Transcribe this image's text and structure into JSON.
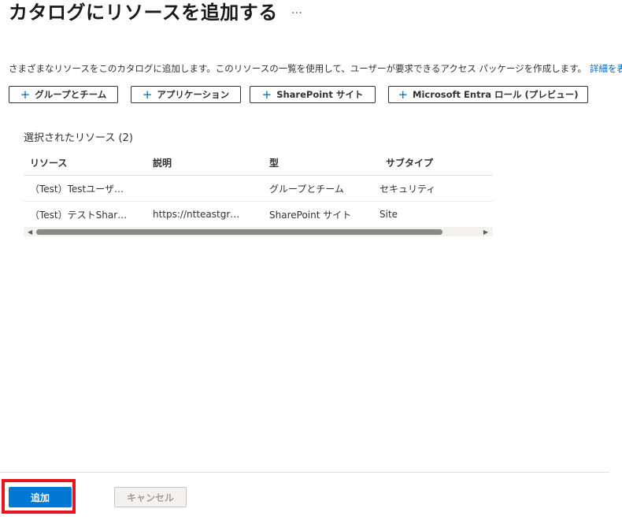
{
  "header": {
    "title": "カタログにリソースを追加する",
    "more_icon": "…"
  },
  "description": {
    "text": "さまざまなリソースをこのカタログに追加します。このリソースの一覧を使用して、ユーザーが要求できるアクセス パッケージを作成します。",
    "link": "詳細を表示"
  },
  "toolbar": {
    "buttons": [
      {
        "icon": "plus-icon",
        "label": "グループとチーム"
      },
      {
        "icon": "plus-icon",
        "label": "アプリケーション"
      },
      {
        "icon": "plus-icon",
        "label": "SharePoint サイト"
      },
      {
        "icon": "plus-icon",
        "label": "Microsoft Entra ロール (プレビュー)"
      }
    ]
  },
  "selected": {
    "label": "選択されたリソース (2)",
    "columns": [
      "リソース",
      "説明",
      "型",
      "サブタイプ"
    ],
    "rows": [
      [
        "（Test）Testユーザ…",
        "",
        "グループとチーム",
        "セキュリティ"
      ],
      [
        "（Test）テストShar…",
        "https://ntteastgr…",
        "SharePoint サイト",
        "Site"
      ]
    ]
  },
  "footer": {
    "add_label": "追加",
    "cancel_label": "キャンセル"
  },
  "colors": {
    "accent": "#0078d4",
    "link": "#0067b8",
    "highlight": "#e8141e"
  }
}
